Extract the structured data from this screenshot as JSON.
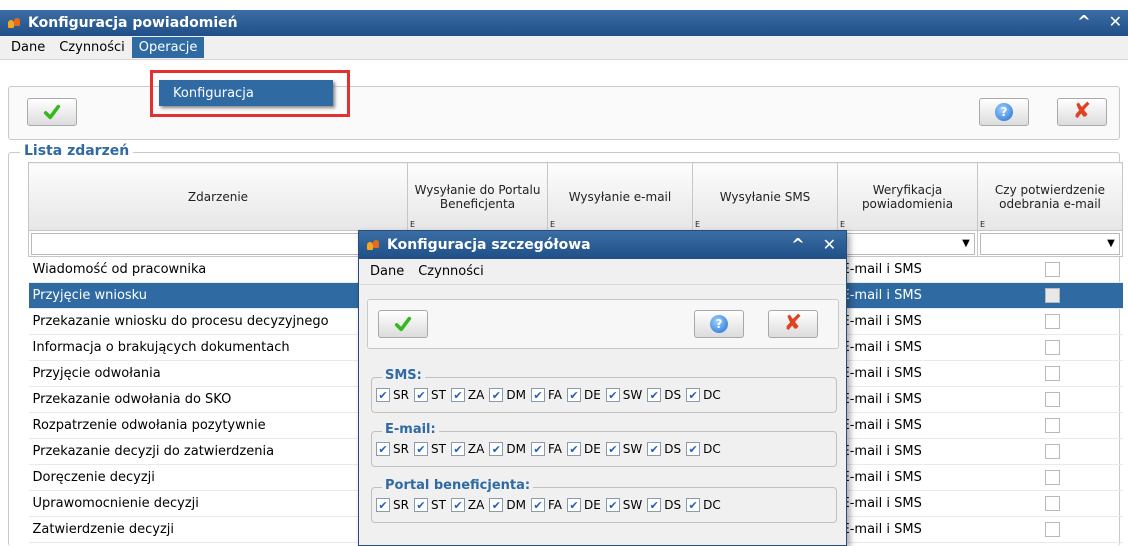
{
  "main_window": {
    "title": "Konfiguracja powiadomień",
    "menu": [
      "Dane",
      "Czynności",
      "Operacje"
    ],
    "active_menu": "Operacje",
    "dropdown_item": "Konfiguracja",
    "help_icon_text": "?",
    "group_title": "Lista zdarzeń"
  },
  "table": {
    "headers": [
      "Zdarzenie",
      "Wysyłanie do Portalu Beneficjenta",
      "Wysyłanie e-mail",
      "Wysyłanie SMS",
      "Weryfikacja powiadomienia",
      "Czy potwierdzenie odebrania e-mail"
    ],
    "header_marker": "E",
    "rows": [
      {
        "event": "Wiadomość od pracownika",
        "verify": "E-mail i SMS"
      },
      {
        "event": "Przyjęcie wniosku",
        "verify": "E-mail i SMS"
      },
      {
        "event": "Przekazanie wniosku do procesu decyzyjnego",
        "verify": "E-mail i SMS"
      },
      {
        "event": "Informacja o brakujących dokumentach",
        "verify": "E-mail i SMS"
      },
      {
        "event": "Przyjęcie odwołania",
        "verify": "E-mail i SMS"
      },
      {
        "event": "Przekazanie odwołania do SKO",
        "verify": "E-mail i SMS"
      },
      {
        "event": "Rozpatrzenie odwołania pozytywnie",
        "verify": "E-mail i SMS"
      },
      {
        "event": "Przekazanie decyzji do zatwierdzenia",
        "verify": "E-mail i SMS"
      },
      {
        "event": "Doręczenie decyzji",
        "verify": "E-mail i SMS"
      },
      {
        "event": "Uprawomocnienie decyzji",
        "verify": "E-mail i SMS"
      },
      {
        "event": "Zatwierdzenie decyzji",
        "verify": "E-mail i SMS"
      }
    ],
    "selected_row": 1
  },
  "dialog": {
    "title": "Konfiguracja szczegółowa",
    "menu": [
      "Dane",
      "Czynności"
    ],
    "help_icon_text": "?",
    "groups": [
      {
        "label": "SMS:",
        "options": [
          "SR",
          "ST",
          "ZA",
          "DM",
          "FA",
          "DE",
          "SW",
          "DS",
          "DC"
        ]
      },
      {
        "label": "E-mail:",
        "options": [
          "SR",
          "ST",
          "ZA",
          "DM",
          "FA",
          "DE",
          "SW",
          "DS",
          "DC"
        ]
      },
      {
        "label": "Portal beneficjenta:",
        "options": [
          "SR",
          "ST",
          "ZA",
          "DM",
          "FA",
          "DE",
          "SW",
          "DS",
          "DC"
        ]
      }
    ]
  },
  "icons": {
    "confirm": "check-icon",
    "help": "help-icon",
    "cancel": "x-icon",
    "minimize": "caret-up-icon",
    "close": "close-icon"
  },
  "colors": {
    "titlebar": "#2f6aa3",
    "selection": "#2f6aa3",
    "highlight_box": "#e53030",
    "confirm_green": "#35b81e",
    "cancel_red": "#e04222"
  }
}
